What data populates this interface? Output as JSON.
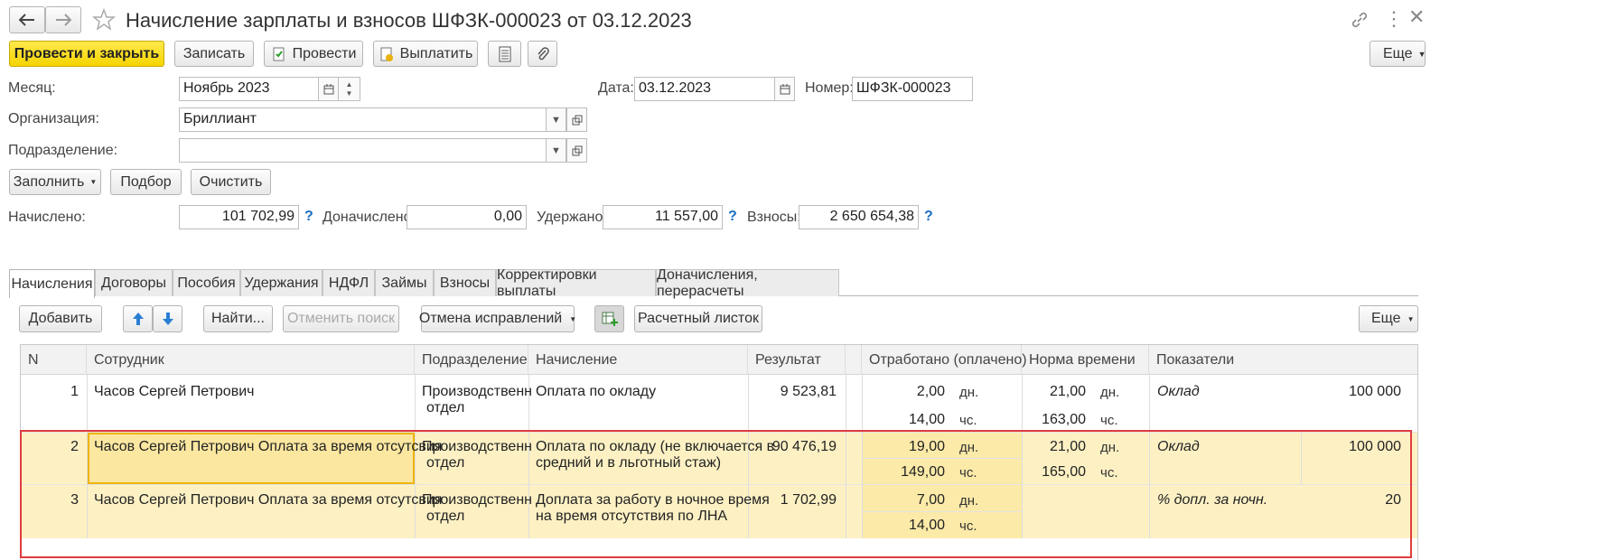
{
  "title": "Начисление зарплаты и взносов ШФЗК-000023 от 03.12.2023",
  "toolbar": {
    "post_close": "Провести и закрыть",
    "save": "Записать",
    "post": "Провести",
    "pay": "Выплатить",
    "more": "Еще"
  },
  "header": {
    "month_label": "Месяц:",
    "month_value": "Ноябрь 2023",
    "date_label": "Дата:",
    "date_value": "03.12.2023",
    "number_label": "Номер:",
    "number_value": "ШФЗК-000023",
    "org_label": "Организация:",
    "org_value": "Бриллиант",
    "dept_label": "Подразделение:",
    "dept_value": ""
  },
  "actions": {
    "fill": "Заполнить",
    "select": "Подбор",
    "clear": "Очистить"
  },
  "totals": {
    "accrued_label": "Начислено:",
    "accrued_value": "101 702,99",
    "additional_label": "Доначислено:",
    "additional_value": "0,00",
    "withheld_label": "Удержано:",
    "withheld_value": "11 557,00",
    "contrib_label": "Взносы:",
    "contrib_value": "2 650 654,38",
    "help": "?"
  },
  "tabs": [
    "Начисления",
    "Договоры",
    "Пособия",
    "Удержания",
    "НДФЛ",
    "Займы",
    "Взносы",
    "Корректировки выплаты",
    "Доначисления, перерасчеты"
  ],
  "table_toolbar": {
    "add": "Добавить",
    "find": "Найти...",
    "cancel_search": "Отменить поиск",
    "cancel_fixes": "Отмена исправлений",
    "payslip": "Расчетный листок",
    "more": "Еще"
  },
  "columns": [
    "N",
    "Сотрудник",
    "Подразделение",
    "Начисление",
    "Результат",
    "Отработано (оплачено)",
    "Норма времени",
    "Показатели"
  ],
  "rows": [
    {
      "n": "1",
      "employee": "Часов Сергей Петрович",
      "dept1": "Производственн",
      "dept2": "отдел",
      "accrual1": "Оплата по окладу",
      "accrual2": "",
      "result": "9 523,81",
      "days": "2,00",
      "hours": "14,00",
      "norm_days": "21,00",
      "norm_hours": "163,00",
      "ind_name": "Оклад",
      "ind_value": "100 000"
    },
    {
      "n": "2",
      "employee": "Часов Сергей Петрович Оплата за время отсутсвия",
      "dept1": "Производственн",
      "dept2": "отдел",
      "accrual1": "Оплата по окладу (не включается в",
      "accrual2": "средний и в льготный стаж)",
      "result": "90 476,19",
      "days": "19,00",
      "hours": "149,00",
      "norm_days": "21,00",
      "norm_hours": "165,00",
      "ind_name": "Оклад",
      "ind_value": "100 000"
    },
    {
      "n": "3",
      "employee": "Часов Сергей Петрович Оплата за время отсутсвия",
      "dept1": "Производственн",
      "dept2": "отдел",
      "accrual1": "Доплата за работу в ночное время",
      "accrual2": "на время отсутствия по ЛНА",
      "result": "1 702,99",
      "days": "7,00",
      "hours": "14,00",
      "norm_days": "",
      "norm_hours": "",
      "ind_name": "% допл. за ночн.",
      "ind_value": "20"
    }
  ],
  "units": {
    "days": "дн.",
    "hours": "чс."
  },
  "colors": {
    "accent": "#f5d400",
    "highlight_row": "#fdf1c4",
    "selection_border": "#e03c3c"
  }
}
